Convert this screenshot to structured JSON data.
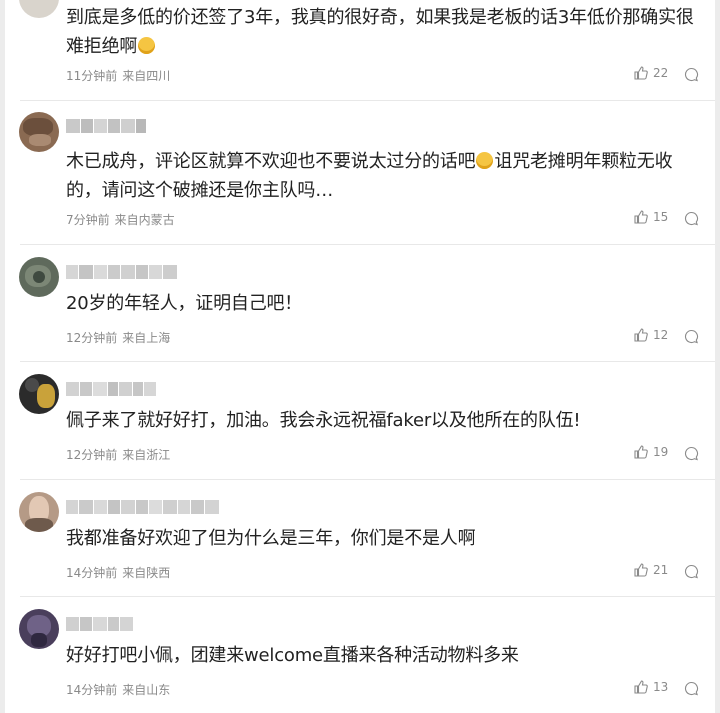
{
  "comments": [
    {
      "text": "到底是多低的价还签了3年，我真的很好奇，如果我是老板的话3年低价那确实很难拒绝啊",
      "has_emoji": true,
      "emoji_name": "laughing-crying-emoji",
      "time": "11分钟前",
      "location": "来自四川",
      "likes": "22"
    },
    {
      "text_before": "木已成舟，评论区就算不欢迎也不要说太过分的话吧",
      "emoji_name": "laughing-crying-emoji",
      "text_after": "诅咒老摊明年颗粒无收的，请问这个破摊还是你主队吗…",
      "time": "7分钟前",
      "location": "来自内蒙古",
      "likes": "15"
    },
    {
      "text": "20岁的年轻人，证明自己吧！",
      "time": "12分钟前",
      "location": "来自上海",
      "likes": "12"
    },
    {
      "text": "佩子来了就好好打，加油。我会永远祝福faker以及他所在的队伍!",
      "time": "12分钟前",
      "location": "来自浙江",
      "likes": "19"
    },
    {
      "text": "我都准备好欢迎了但为什么是三年，你们是不是人啊",
      "time": "14分钟前",
      "location": "来自陕西",
      "likes": "21"
    },
    {
      "text": "好好打吧小佩，团建来welcome直播来各种活动物料多来",
      "time": "14分钟前",
      "location": "来自山东",
      "likes": "13"
    }
  ],
  "colors": {
    "text": "#222222",
    "meta": "#8a8a8a",
    "background": "#ffffff",
    "page_bg": "#ececec"
  },
  "icons": {
    "like": "thumbs-up-icon",
    "reply": "comment-bubble-icon"
  }
}
